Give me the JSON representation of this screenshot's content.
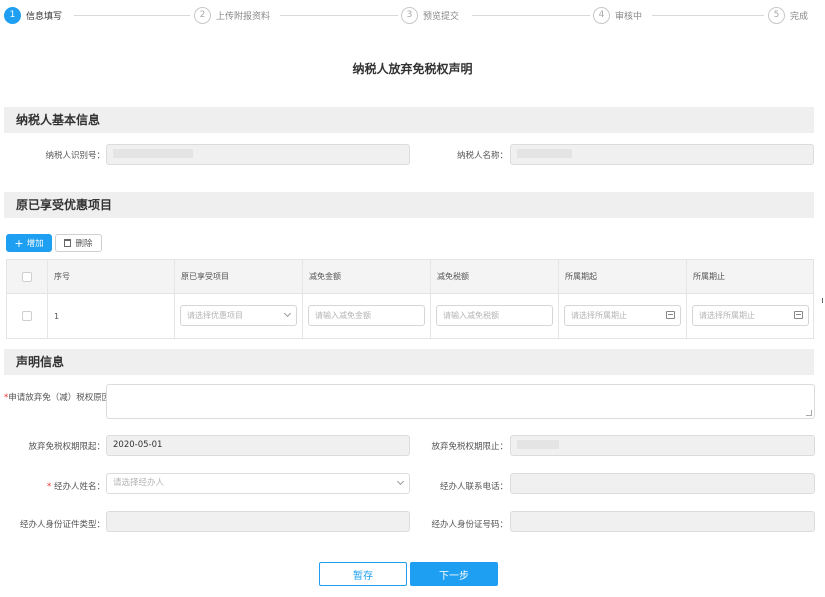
{
  "steps": [
    {
      "num": "1",
      "label": "信息填写"
    },
    {
      "num": "2",
      "label": "上传附报资料"
    },
    {
      "num": "3",
      "label": "预览提交"
    },
    {
      "num": "4",
      "label": "审核中"
    },
    {
      "num": "5",
      "label": "完成"
    }
  ],
  "page_title": "纳税人放弃免税权声明",
  "basic_info": {
    "header": "纳税人基本信息",
    "taxpayer_id_label": "纳税人识别号：",
    "taxpayer_name_label": "纳税人名称："
  },
  "preferential": {
    "header": "原已享受优惠项目",
    "add_label": "增加",
    "delete_label": "删除",
    "columns": [
      "序号",
      "原已享受项目",
      "减免金额",
      "减免税额",
      "所属期起",
      "所属期止"
    ],
    "rows": [
      {
        "index": "1",
        "project_placeholder": "请选择优惠项目",
        "amount_placeholder": "请输入减免金额",
        "tax_placeholder": "请输入减免税额",
        "start_placeholder": "请选择所属期止",
        "end_placeholder": "请选择所属期止"
      }
    ]
  },
  "declaration": {
    "header": "声明信息",
    "reason_label": "申请放弃免（减）税权原因：",
    "start_label": "放弃免税权期限起：",
    "start_value": "2020-05-01",
    "end_label": "放弃免税权期限止：",
    "agent_name_label": "经办人姓名：",
    "agent_name_placeholder": "请选择经办人",
    "agent_phone_label": "经办人联系电话：",
    "agent_id_type_label": "经办人身份证件类型：",
    "agent_id_no_label": "经办人身份证号码："
  },
  "buttons": {
    "save": "暂存",
    "next": "下一步"
  }
}
